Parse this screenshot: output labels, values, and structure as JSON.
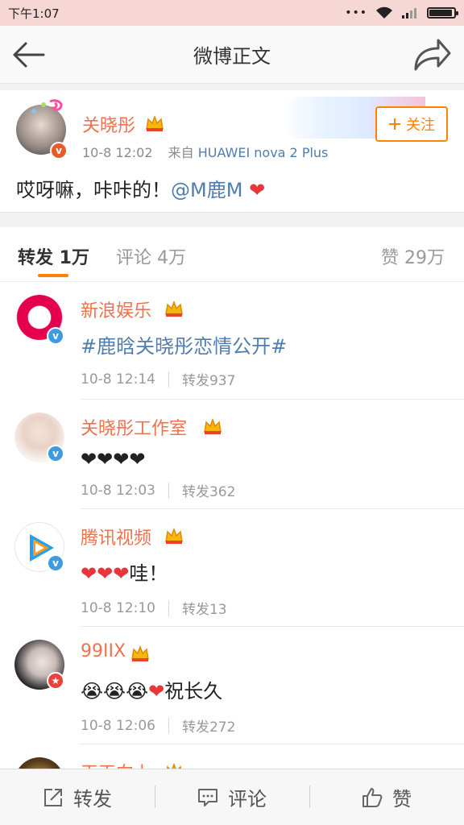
{
  "status_bar": {
    "time": "下午1:07"
  },
  "nav": {
    "title": "微博正文"
  },
  "post": {
    "author": "关晓彤",
    "time": "10-8 12:02",
    "source_prefix": "来自",
    "source": "HUAWEI nova 2 Plus",
    "follow_label": "关注",
    "text": "哎呀嘛，咔咔的！",
    "mention": "@M鹿M",
    "emoji": "❤"
  },
  "tabs": {
    "repost": "转发 1万",
    "comment": "评论 4万",
    "like": "赞 29万"
  },
  "reposts": [
    {
      "name": "新浪娱乐",
      "content": "#鹿晗关晓彤恋情公开#",
      "time": "10-8 12:14",
      "count": "转发937"
    },
    {
      "name": "关晓彤工作室",
      "content": "❤❤❤❤",
      "time": "10-8 12:03",
      "count": "转发362"
    },
    {
      "name": "腾讯视频",
      "content": "❤❤❤",
      "content_suffix": "哇！",
      "time": "10-8 12:10",
      "count": "转发13"
    },
    {
      "name": "99IIX",
      "content": "😭😭😭",
      "content_heart": "❤",
      "content_suffix": "祝长久",
      "time": "10-8 12:06",
      "count": "转发272"
    },
    {
      "name": "天天向上"
    }
  ],
  "bottom": {
    "repost": "转发",
    "comment": "评论",
    "like": "赞"
  },
  "colors": {
    "accent": "#ff8200",
    "name": "#eb7350",
    "link": "#507daf",
    "heart": "#e8363a"
  }
}
